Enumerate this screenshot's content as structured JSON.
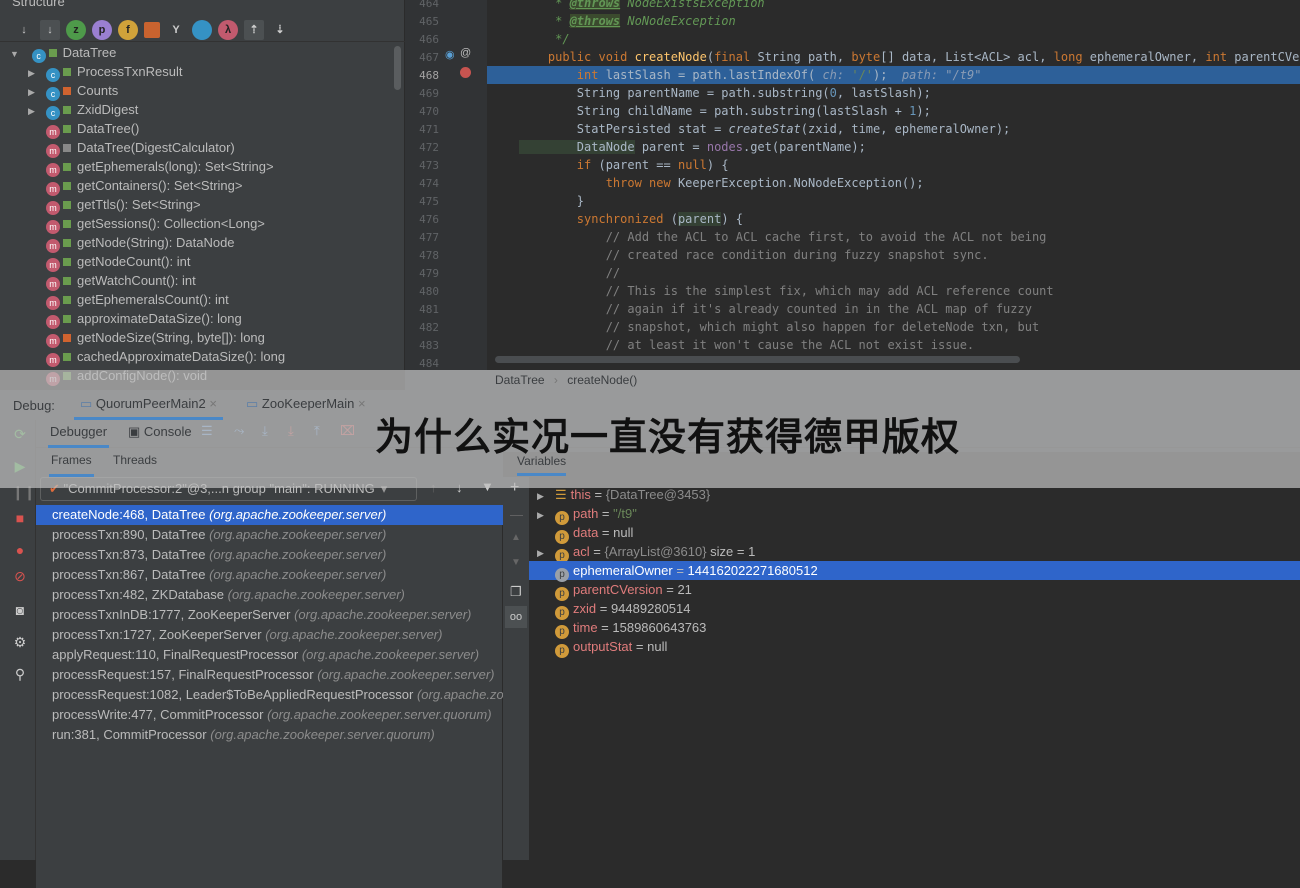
{
  "structure": {
    "title": "Structure",
    "root": "DataTree",
    "items": [
      {
        "label": "ProcessTxnResult",
        "icon": "c",
        "lock": "#6a9c4e",
        "arrow": true
      },
      {
        "label": "Counts",
        "icon": "c",
        "lock": "#d0632f",
        "arrow": true
      },
      {
        "label": "ZxidDigest",
        "icon": "c",
        "lock": "#6a9c4e",
        "arrow": true
      },
      {
        "label": "DataTree()",
        "icon": "m",
        "lock": "#6a9c4e"
      },
      {
        "label": "DataTree(DigestCalculator)",
        "icon": "m",
        "lock": "#888"
      },
      {
        "label": "getEphemerals(long): Set<String>",
        "icon": "m",
        "lock": "#6a9c4e"
      },
      {
        "label": "getContainers(): Set<String>",
        "icon": "m",
        "lock": "#6a9c4e"
      },
      {
        "label": "getTtls(): Set<String>",
        "icon": "m",
        "lock": "#6a9c4e"
      },
      {
        "label": "getSessions(): Collection<Long>",
        "icon": "m",
        "lock": "#6a9c4e"
      },
      {
        "label": "getNode(String): DataNode",
        "icon": "m",
        "lock": "#6a9c4e"
      },
      {
        "label": "getNodeCount(): int",
        "icon": "m",
        "lock": "#6a9c4e"
      },
      {
        "label": "getWatchCount(): int",
        "icon": "m",
        "lock": "#6a9c4e"
      },
      {
        "label": "getEphemeralsCount(): int",
        "icon": "m",
        "lock": "#6a9c4e"
      },
      {
        "label": "approximateDataSize(): long",
        "icon": "m",
        "lock": "#6a9c4e"
      },
      {
        "label": "getNodeSize(String, byte[]): long",
        "icon": "m",
        "lock": "#d0632f"
      },
      {
        "label": "cachedApproximateDataSize(): long",
        "icon": "m",
        "lock": "#6a9c4e"
      },
      {
        "label": "addConfigNode(): void",
        "icon": "m",
        "lock": "#6a9c4e"
      }
    ]
  },
  "editor": {
    "current_line": 468,
    "lines": [
      {
        "n": "464",
        "t": [
          [
            "cd",
            "     * "
          ],
          [
            "tag",
            "@throws"
          ],
          [
            "cd",
            " NodeExistsException"
          ]
        ]
      },
      {
        "n": "465",
        "t": [
          [
            "cd",
            "     * "
          ],
          [
            "tag",
            "@throws"
          ],
          [
            "cd",
            " NoNodeException"
          ]
        ]
      },
      {
        "n": "466",
        "t": [
          [
            "cd",
            "     */"
          ]
        ]
      },
      {
        "n": "467",
        "t": [
          [
            "k",
            "    public void "
          ],
          [
            "f",
            "createNode"
          ],
          [
            "",
            "("
          ],
          [
            "k",
            "final "
          ],
          [
            "",
            "String path, "
          ],
          [
            "k",
            "byte"
          ],
          [
            "",
            "[] data, List<ACL> acl, "
          ],
          [
            "k",
            "long "
          ],
          [
            "",
            "ephemeralOwner, "
          ],
          [
            "k",
            "int "
          ],
          [
            "",
            "parentCVersion, l"
          ]
        ]
      },
      {
        "n": "468",
        "t": [
          [
            "k",
            "        int "
          ],
          [
            "",
            "lastSlash = path.lastIndexOf("
          ],
          [
            "hint",
            " ch: "
          ],
          [
            "s",
            "'/'"
          ],
          [
            "",
            "); "
          ],
          [
            "hint",
            " path: \"/t9\""
          ]
        ]
      },
      {
        "n": "469",
        "t": [
          [
            "",
            "        String parentName = path.substring("
          ],
          [
            "n",
            "0"
          ],
          [
            "",
            ", lastSlash);"
          ]
        ]
      },
      {
        "n": "470",
        "t": [
          [
            "",
            "        String childName = path.substring(lastSlash + "
          ],
          [
            "n",
            "1"
          ],
          [
            "",
            ");"
          ]
        ]
      },
      {
        "n": "471",
        "t": [
          [
            "",
            "        StatPersisted stat = "
          ],
          [
            "i",
            "createStat"
          ],
          [
            "",
            "(zxid, time, ephemeralOwner);"
          ]
        ]
      },
      {
        "n": "472",
        "t": [
          [
            "type",
            "        DataNode"
          ],
          [
            "",
            " parent = "
          ],
          [
            "mv",
            "nodes"
          ],
          [
            "",
            ".get(parentName);"
          ]
        ]
      },
      {
        "n": "473",
        "t": [
          [
            "k",
            "        if "
          ],
          [
            "",
            "(parent == "
          ],
          [
            "k",
            "null"
          ],
          [
            "",
            ") {"
          ]
        ]
      },
      {
        "n": "474",
        "t": [
          [
            "k",
            "            throw new "
          ],
          [
            "",
            "KeeperException.NoNodeException();"
          ]
        ]
      },
      {
        "n": "475",
        "t": [
          [
            "",
            "        }"
          ]
        ]
      },
      {
        "n": "476",
        "t": [
          [
            "k",
            "        synchronized "
          ],
          [
            "",
            "("
          ],
          [
            "type",
            "parent"
          ],
          [
            "",
            ") {"
          ]
        ]
      },
      {
        "n": "477",
        "t": [
          [
            "cm",
            "            // Add the ACL to ACL cache first, to avoid the ACL not being"
          ]
        ]
      },
      {
        "n": "478",
        "t": [
          [
            "cm",
            "            // created race condition during fuzzy snapshot sync."
          ]
        ]
      },
      {
        "n": "479",
        "t": [
          [
            "cm",
            "            //"
          ]
        ]
      },
      {
        "n": "480",
        "t": [
          [
            "cm",
            "            // This is the simplest fix, which may add ACL reference count"
          ]
        ]
      },
      {
        "n": "481",
        "t": [
          [
            "cm",
            "            // again if it's already counted in in the ACL map of fuzzy"
          ]
        ]
      },
      {
        "n": "482",
        "t": [
          [
            "cm",
            "            // snapshot, which might also happen for deleteNode txn, but"
          ]
        ]
      },
      {
        "n": "483",
        "t": [
          [
            "cm",
            "            // at least it won't cause the ACL not exist issue."
          ]
        ]
      },
      {
        "n": "484",
        "t": []
      }
    ],
    "breadcrumb": [
      "DataTree",
      "createNode()"
    ]
  },
  "debug": {
    "label": "Debug:",
    "sessions": [
      "QuorumPeerMain2",
      "ZooKeeperMain"
    ],
    "tabs": [
      "Debugger",
      "Console"
    ],
    "subtabs": [
      "Frames",
      "Threads"
    ],
    "variables_title": "Variables",
    "thread": "\"CommitProcessor:2\"@3,...n group \"main\": RUNNING",
    "frames": [
      {
        "m": "createNode:468, DataTree",
        "p": "(org.apache.zookeeper.server)"
      },
      {
        "m": "processTxn:890, DataTree",
        "p": "(org.apache.zookeeper.server)"
      },
      {
        "m": "processTxn:873, DataTree",
        "p": "(org.apache.zookeeper.server)"
      },
      {
        "m": "processTxn:867, DataTree",
        "p": "(org.apache.zookeeper.server)"
      },
      {
        "m": "processTxn:482, ZKDatabase",
        "p": "(org.apache.zookeeper.server)"
      },
      {
        "m": "processTxnInDB:1777, ZooKeeperServer",
        "p": "(org.apache.zookeeper.server)"
      },
      {
        "m": "processTxn:1727, ZooKeeperServer",
        "p": "(org.apache.zookeeper.server)"
      },
      {
        "m": "applyRequest:110, FinalRequestProcessor",
        "p": "(org.apache.zookeeper.server)"
      },
      {
        "m": "processRequest:157, FinalRequestProcessor",
        "p": "(org.apache.zookeeper.server)"
      },
      {
        "m": "processRequest:1082, Leader$ToBeAppliedRequestProcessor",
        "p": "(org.apache.zookeeper.server.quorum)"
      },
      {
        "m": "processWrite:477, CommitProcessor",
        "p": "(org.apache.zookeeper.server.quorum)"
      },
      {
        "m": "run:381, CommitProcessor",
        "p": "(org.apache.zookeeper.server.quorum)"
      }
    ],
    "variables": [
      {
        "name": "this",
        "eq": " = ",
        "val": "{DataTree@3453}",
        "kind": "obj",
        "arrow": true,
        "icon": "list"
      },
      {
        "name": "path",
        "eq": " = ",
        "val": "\"/t9\"",
        "kind": "str",
        "arrow": true
      },
      {
        "name": "data",
        "eq": " = ",
        "val": "null",
        "kind": "plain"
      },
      {
        "name": "acl",
        "eq": " = ",
        "val": "{ArrayList@3610}",
        "extra": "  size = 1",
        "kind": "obj",
        "arrow": true
      },
      {
        "name": "ephemeralOwner",
        "eq": " = ",
        "val": "144162022271680512",
        "kind": "plain",
        "selected": true
      },
      {
        "name": "parentCVersion",
        "eq": " = ",
        "val": "21",
        "kind": "plain"
      },
      {
        "name": "zxid",
        "eq": " = ",
        "val": "94489280514",
        "kind": "plain"
      },
      {
        "name": "time",
        "eq": " = ",
        "val": "1589860643763",
        "kind": "plain"
      },
      {
        "name": "outputStat",
        "eq": " = ",
        "val": "null",
        "kind": "plain"
      }
    ]
  },
  "banner": {
    "title": "为什么实况一直没有获得德甲版权"
  }
}
